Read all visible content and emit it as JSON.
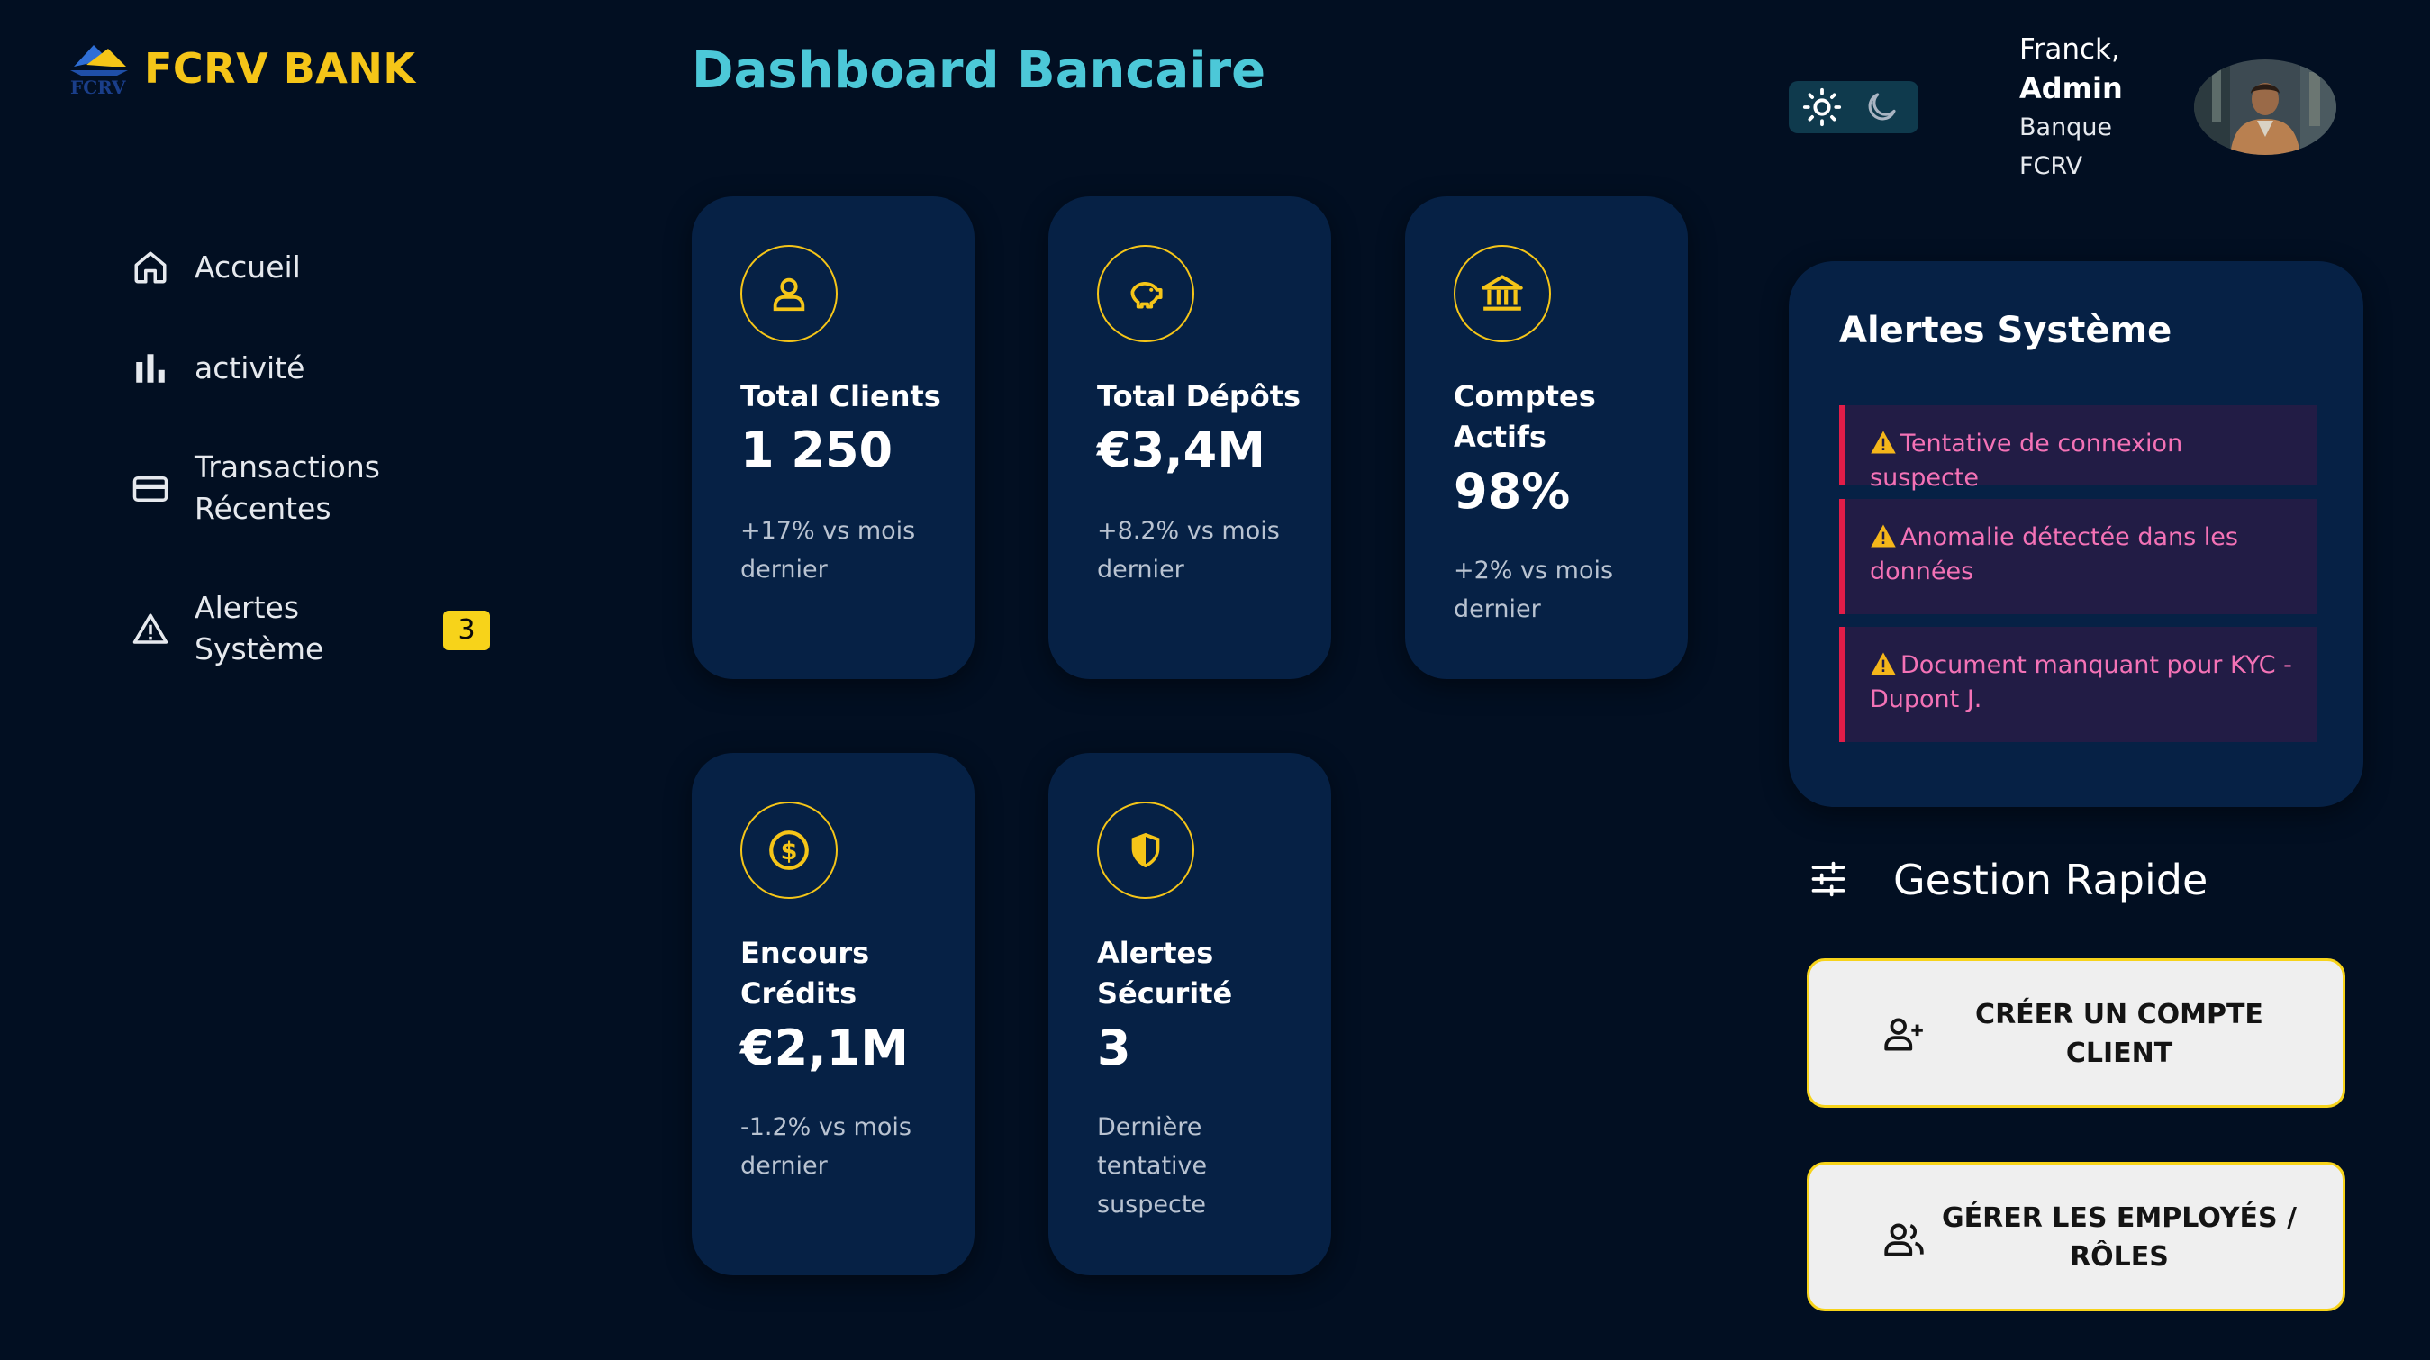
{
  "brand": {
    "name": "FCRV BANK",
    "logo_text": "FCRV"
  },
  "sidebar": {
    "items": [
      {
        "label_line1": "Accueil",
        "label_line2": "",
        "icon": "home-icon"
      },
      {
        "label_line1": "activité",
        "label_line2": "",
        "icon": "bar-chart-icon"
      },
      {
        "label_line1": "Transactions",
        "label_line2": "Récentes",
        "icon": "credit-card-icon"
      },
      {
        "label_line1": "Alertes",
        "label_line2": "Système",
        "icon": "warning-icon",
        "badge": "3"
      }
    ]
  },
  "header": {
    "title": "Dashboard Bancaire"
  },
  "theme_toggle": {
    "light_icon": "sun-icon",
    "dark_icon": "moon-icon"
  },
  "user": {
    "name": "Franck,",
    "role": "Admin",
    "org_line1": "Banque",
    "org_line2": "FCRV"
  },
  "cards": [
    {
      "icon": "user-icon",
      "label": "Total Clients",
      "value": "1 250",
      "sub": "+17% vs mois dernier"
    },
    {
      "icon": "piggy-bank-icon",
      "label": "Total Dépôts",
      "value": "€3,4M",
      "sub": "+8.2% vs mois dernier"
    },
    {
      "icon": "bank-icon",
      "label": "Comptes Actifs",
      "value": "98%",
      "sub": "+2% vs mois dernier"
    },
    {
      "icon": "dollar-coin-icon",
      "label": "Encours Crédits",
      "value": "€2,1M",
      "sub": "-1.2% vs mois dernier"
    },
    {
      "icon": "shield-icon",
      "label": "Alertes Sécurité",
      "value": "3",
      "sub": "Dernière tentative suspecte"
    }
  ],
  "alerts": {
    "title": "Alertes Système",
    "items": [
      {
        "text": "Tentative de connexion suspecte"
      },
      {
        "text": "Anomalie détectée dans les données"
      },
      {
        "text": "Document manquant pour KYC - Dupont J."
      }
    ]
  },
  "gestion": {
    "title": "Gestion Rapide",
    "icon": "sliders-icon",
    "actions": [
      {
        "label": "CRÉER UN COMPTE CLIENT",
        "icon": "user-plus-icon"
      },
      {
        "label": "GÉRER LES EMPLOYÉS / RÔLES",
        "icon": "users-icon"
      }
    ]
  },
  "colors": {
    "background": "#020f22",
    "card": "#062145",
    "accent_yellow": "#f5c518",
    "title_cyan": "#4cc8d8",
    "alert_pink": "#f472b6",
    "alert_border": "#e11d48"
  }
}
